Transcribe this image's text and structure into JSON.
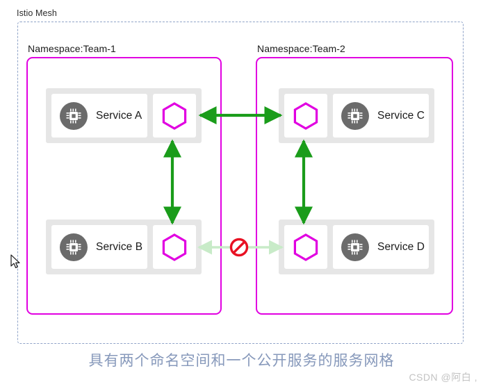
{
  "mesh": {
    "label": "Istio Mesh",
    "boundary_color": "#8fa3c8"
  },
  "namespaces": [
    {
      "id": "team-1",
      "label": "Namespace:Team-1",
      "border_color": "#e100e1"
    },
    {
      "id": "team-2",
      "label": "Namespace:Team-2",
      "border_color": "#e100e1"
    }
  ],
  "services": [
    {
      "id": "service-a",
      "label": "Service A",
      "namespace": "team-1",
      "proxy": "envoy-sidecar-hexagon",
      "icon": "chip-icon"
    },
    {
      "id": "service-b",
      "label": "Service B",
      "namespace": "team-1",
      "proxy": "envoy-sidecar-hexagon",
      "icon": "chip-icon"
    },
    {
      "id": "service-c",
      "label": "Service C",
      "namespace": "team-2",
      "proxy": "envoy-sidecar-hexagon",
      "icon": "chip-icon"
    },
    {
      "id": "service-d",
      "label": "Service D",
      "namespace": "team-2",
      "proxy": "envoy-sidecar-hexagon",
      "icon": "chip-icon"
    }
  ],
  "connections": [
    {
      "id": "a-to-c",
      "from": "service-a",
      "to": "service-c",
      "state": "allowed",
      "direction": "bidirectional",
      "color": "#1a9c1a"
    },
    {
      "id": "a-to-b",
      "from": "service-a",
      "to": "service-b",
      "state": "allowed",
      "direction": "bidirectional",
      "color": "#1a9c1a"
    },
    {
      "id": "c-to-d",
      "from": "service-c",
      "to": "service-d",
      "state": "allowed",
      "direction": "bidirectional",
      "color": "#1a9c1a"
    },
    {
      "id": "b-to-d",
      "from": "service-b",
      "to": "service-d",
      "state": "blocked",
      "direction": "bidirectional",
      "color": "#c8ebc8",
      "badge": "no-entry-icon",
      "badge_color": "#e81123"
    }
  ],
  "colors": {
    "magenta": "#e100e1",
    "green": "#1a9c1a",
    "pale_green": "#c8ebc8",
    "red": "#e81123",
    "pod_background": "#e6e6e6",
    "chip_circle": "#6b6b6b",
    "caption": "#8799bb"
  },
  "caption": "具有两个命名空间和一个公开服务的服务网格",
  "watermark": "CSDN @阿白 ,"
}
